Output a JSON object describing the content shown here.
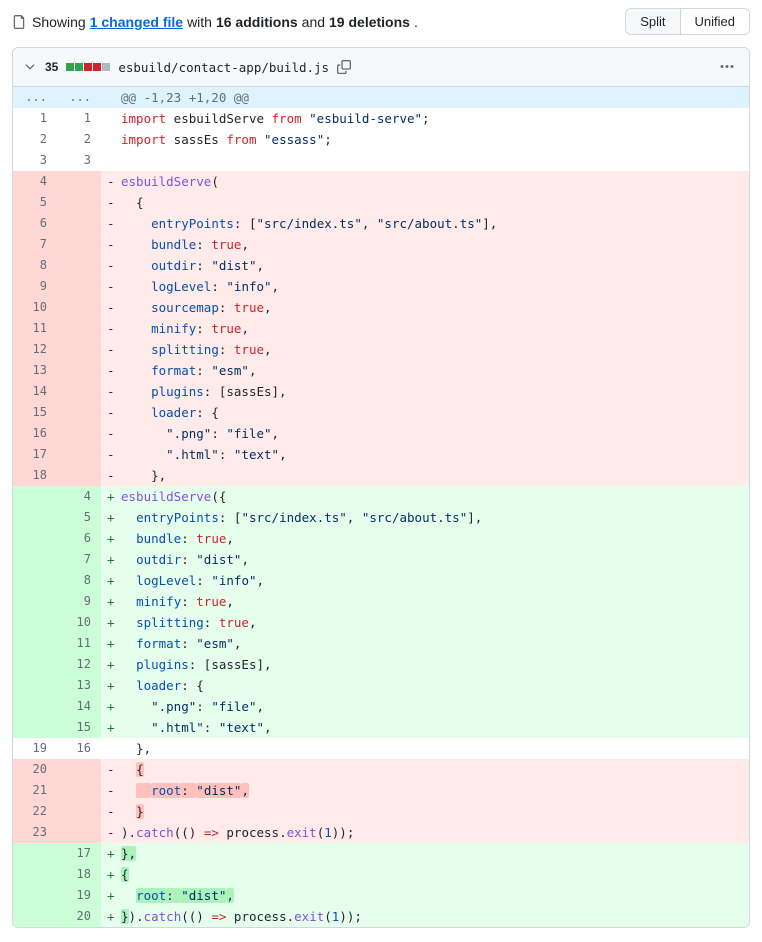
{
  "summary": {
    "prefix": "Showing",
    "files_link": "1 changed file",
    "middle": "with",
    "additions": "16 additions",
    "and": "and",
    "deletions": "19 deletions",
    "suffix": "."
  },
  "view_toggle": {
    "split": "Split",
    "unified": "Unified"
  },
  "file": {
    "diff_count": "35",
    "path": "esbuild/contact-app/build.js",
    "diffstat": [
      "add",
      "add",
      "del",
      "del",
      "neutral"
    ]
  },
  "hunk_header": "@@ -1,23 +1,20 @@",
  "lines": [
    {
      "t": "hunk",
      "old": "...",
      "new": "...",
      "code_key": "hunk"
    },
    {
      "t": "ctx",
      "old": "1",
      "new": "1",
      "tokens": [
        [
          "kw",
          "import"
        ],
        [
          "plain",
          " esbuildServe "
        ],
        [
          "kw",
          "from"
        ],
        [
          "plain",
          " "
        ],
        [
          "str",
          "\"esbuild-serve\""
        ],
        [
          "plain",
          ";"
        ]
      ]
    },
    {
      "t": "ctx",
      "old": "2",
      "new": "2",
      "tokens": [
        [
          "kw",
          "import"
        ],
        [
          "plain",
          " sassEs "
        ],
        [
          "kw",
          "from"
        ],
        [
          "plain",
          " "
        ],
        [
          "str",
          "\"essass\""
        ],
        [
          "plain",
          ";"
        ]
      ]
    },
    {
      "t": "ctx",
      "old": "3",
      "new": "3",
      "tokens": []
    },
    {
      "t": "del",
      "old": "4",
      "tokens": [
        [
          "fn",
          "esbuildServe"
        ],
        [
          "plain",
          "("
        ]
      ]
    },
    {
      "t": "del",
      "old": "5",
      "tokens": [
        [
          "plain",
          "  {"
        ]
      ]
    },
    {
      "t": "del",
      "old": "6",
      "tokens": [
        [
          "plain",
          "    "
        ],
        [
          "prop",
          "entryPoints"
        ],
        [
          "plain",
          ": ["
        ],
        [
          "str",
          "\"src/index.ts\""
        ],
        [
          "plain",
          ", "
        ],
        [
          "str",
          "\"src/about.ts\""
        ],
        [
          "plain",
          "],"
        ]
      ]
    },
    {
      "t": "del",
      "old": "7",
      "tokens": [
        [
          "plain",
          "    "
        ],
        [
          "prop",
          "bundle"
        ],
        [
          "plain",
          ": "
        ],
        [
          "kw",
          "true"
        ],
        [
          "plain",
          ","
        ]
      ]
    },
    {
      "t": "del",
      "old": "8",
      "tokens": [
        [
          "plain",
          "    "
        ],
        [
          "prop",
          "outdir"
        ],
        [
          "plain",
          ": "
        ],
        [
          "str",
          "\"dist\""
        ],
        [
          "plain",
          ","
        ]
      ]
    },
    {
      "t": "del",
      "old": "9",
      "tokens": [
        [
          "plain",
          "    "
        ],
        [
          "prop",
          "logLevel"
        ],
        [
          "plain",
          ": "
        ],
        [
          "str",
          "\"info\""
        ],
        [
          "plain",
          ","
        ]
      ]
    },
    {
      "t": "del",
      "old": "10",
      "tokens": [
        [
          "plain",
          "    "
        ],
        [
          "prop",
          "sourcemap"
        ],
        [
          "plain",
          ": "
        ],
        [
          "kw",
          "true"
        ],
        [
          "plain",
          ","
        ]
      ]
    },
    {
      "t": "del",
      "old": "11",
      "tokens": [
        [
          "plain",
          "    "
        ],
        [
          "prop",
          "minify"
        ],
        [
          "plain",
          ": "
        ],
        [
          "kw",
          "true"
        ],
        [
          "plain",
          ","
        ]
      ]
    },
    {
      "t": "del",
      "old": "12",
      "tokens": [
        [
          "plain",
          "    "
        ],
        [
          "prop",
          "splitting"
        ],
        [
          "plain",
          ": "
        ],
        [
          "kw",
          "true"
        ],
        [
          "plain",
          ","
        ]
      ]
    },
    {
      "t": "del",
      "old": "13",
      "tokens": [
        [
          "plain",
          "    "
        ],
        [
          "prop",
          "format"
        ],
        [
          "plain",
          ": "
        ],
        [
          "str",
          "\"esm\""
        ],
        [
          "plain",
          ","
        ]
      ]
    },
    {
      "t": "del",
      "old": "14",
      "tokens": [
        [
          "plain",
          "    "
        ],
        [
          "prop",
          "plugins"
        ],
        [
          "plain",
          ": [sassEs],"
        ]
      ]
    },
    {
      "t": "del",
      "old": "15",
      "tokens": [
        [
          "plain",
          "    "
        ],
        [
          "prop",
          "loader"
        ],
        [
          "plain",
          ": {"
        ]
      ]
    },
    {
      "t": "del",
      "old": "16",
      "tokens": [
        [
          "plain",
          "      "
        ],
        [
          "str",
          "\".png\""
        ],
        [
          "plain",
          ": "
        ],
        [
          "str",
          "\"file\""
        ],
        [
          "plain",
          ","
        ]
      ]
    },
    {
      "t": "del",
      "old": "17",
      "tokens": [
        [
          "plain",
          "      "
        ],
        [
          "str",
          "\".html\""
        ],
        [
          "plain",
          ": "
        ],
        [
          "str",
          "\"text\""
        ],
        [
          "plain",
          ","
        ]
      ]
    },
    {
      "t": "del",
      "old": "18",
      "tokens": [
        [
          "plain",
          "    },"
        ]
      ]
    },
    {
      "t": "add",
      "new": "4",
      "tokens": [
        [
          "fn",
          "esbuildServe"
        ],
        [
          "plain",
          "({"
        ]
      ]
    },
    {
      "t": "add",
      "new": "5",
      "tokens": [
        [
          "plain",
          "  "
        ],
        [
          "prop",
          "entryPoints"
        ],
        [
          "plain",
          ": ["
        ],
        [
          "str",
          "\"src/index.ts\""
        ],
        [
          "plain",
          ", "
        ],
        [
          "str",
          "\"src/about.ts\""
        ],
        [
          "plain",
          "],"
        ]
      ]
    },
    {
      "t": "add",
      "new": "6",
      "tokens": [
        [
          "plain",
          "  "
        ],
        [
          "prop",
          "bundle"
        ],
        [
          "plain",
          ": "
        ],
        [
          "kw",
          "true"
        ],
        [
          "plain",
          ","
        ]
      ]
    },
    {
      "t": "add",
      "new": "7",
      "tokens": [
        [
          "plain",
          "  "
        ],
        [
          "prop",
          "outdir"
        ],
        [
          "plain",
          ": "
        ],
        [
          "str",
          "\"dist\""
        ],
        [
          "plain",
          ","
        ]
      ]
    },
    {
      "t": "add",
      "new": "8",
      "tokens": [
        [
          "plain",
          "  "
        ],
        [
          "prop",
          "logLevel"
        ],
        [
          "plain",
          ": "
        ],
        [
          "str",
          "\"info\""
        ],
        [
          "plain",
          ","
        ]
      ]
    },
    {
      "t": "add",
      "new": "9",
      "tokens": [
        [
          "plain",
          "  "
        ],
        [
          "prop",
          "minify"
        ],
        [
          "plain",
          ": "
        ],
        [
          "kw",
          "true"
        ],
        [
          "plain",
          ","
        ]
      ]
    },
    {
      "t": "add",
      "new": "10",
      "tokens": [
        [
          "plain",
          "  "
        ],
        [
          "prop",
          "splitting"
        ],
        [
          "plain",
          ": "
        ],
        [
          "kw",
          "true"
        ],
        [
          "plain",
          ","
        ]
      ]
    },
    {
      "t": "add",
      "new": "11",
      "tokens": [
        [
          "plain",
          "  "
        ],
        [
          "prop",
          "format"
        ],
        [
          "plain",
          ": "
        ],
        [
          "str",
          "\"esm\""
        ],
        [
          "plain",
          ","
        ]
      ]
    },
    {
      "t": "add",
      "new": "12",
      "tokens": [
        [
          "plain",
          "  "
        ],
        [
          "prop",
          "plugins"
        ],
        [
          "plain",
          ": [sassEs],"
        ]
      ]
    },
    {
      "t": "add",
      "new": "13",
      "tokens": [
        [
          "plain",
          "  "
        ],
        [
          "prop",
          "loader"
        ],
        [
          "plain",
          ": {"
        ]
      ]
    },
    {
      "t": "add",
      "new": "14",
      "tokens": [
        [
          "plain",
          "    "
        ],
        [
          "str",
          "\".png\""
        ],
        [
          "plain",
          ": "
        ],
        [
          "str",
          "\"file\""
        ],
        [
          "plain",
          ","
        ]
      ]
    },
    {
      "t": "add",
      "new": "15",
      "tokens": [
        [
          "plain",
          "    "
        ],
        [
          "str",
          "\".html\""
        ],
        [
          "plain",
          ": "
        ],
        [
          "str",
          "\"text\""
        ],
        [
          "plain",
          ","
        ]
      ]
    },
    {
      "t": "ctx",
      "old": "19",
      "new": "16",
      "tokens": [
        [
          "plain",
          "  },"
        ]
      ]
    },
    {
      "t": "del",
      "old": "20",
      "tokens": [
        [
          "plain",
          "  "
        ],
        [
          "hl-del",
          "{"
        ]
      ]
    },
    {
      "t": "del",
      "old": "21",
      "tokens": [
        [
          "plain",
          "  "
        ],
        [
          "hl-del",
          "  "
        ],
        [
          "hl-del-prop",
          "root"
        ],
        [
          "hl-del",
          ": "
        ],
        [
          "hl-del-str",
          "\"dist\""
        ],
        [
          "hl-del",
          ","
        ]
      ]
    },
    {
      "t": "del",
      "old": "22",
      "tokens": [
        [
          "plain",
          "  "
        ],
        [
          "hl-del",
          "}"
        ]
      ]
    },
    {
      "t": "del",
      "old": "23",
      "tokens": [
        [
          "plain",
          ")."
        ],
        [
          "fn",
          "catch"
        ],
        [
          "plain",
          "(() "
        ],
        [
          "kw",
          "=>"
        ],
        [
          "plain",
          " process."
        ],
        [
          "fn",
          "exit"
        ],
        [
          "plain",
          "("
        ],
        [
          "num-lit",
          "1"
        ],
        [
          "plain",
          "));"
        ]
      ]
    },
    {
      "t": "add",
      "new": "17",
      "tokens": [
        [
          "hl-add",
          "},"
        ]
      ]
    },
    {
      "t": "add",
      "new": "18",
      "tokens": [
        [
          "hl-add",
          "{"
        ]
      ]
    },
    {
      "t": "add",
      "new": "19",
      "tokens": [
        [
          "plain",
          "  "
        ],
        [
          "hl-add-prop",
          "root"
        ],
        [
          "hl-add",
          ": "
        ],
        [
          "hl-add-str",
          "\"dist\""
        ],
        [
          "hl-add",
          ","
        ]
      ]
    },
    {
      "t": "add",
      "new": "20",
      "tokens": [
        [
          "hl-add",
          "}"
        ],
        [
          "plain",
          ")."
        ],
        [
          "fn",
          "catch"
        ],
        [
          "plain",
          "(() "
        ],
        [
          "kw",
          "=>"
        ],
        [
          "plain",
          " process."
        ],
        [
          "fn",
          "exit"
        ],
        [
          "plain",
          "("
        ],
        [
          "num-lit",
          "1"
        ],
        [
          "plain",
          "));"
        ]
      ]
    }
  ]
}
